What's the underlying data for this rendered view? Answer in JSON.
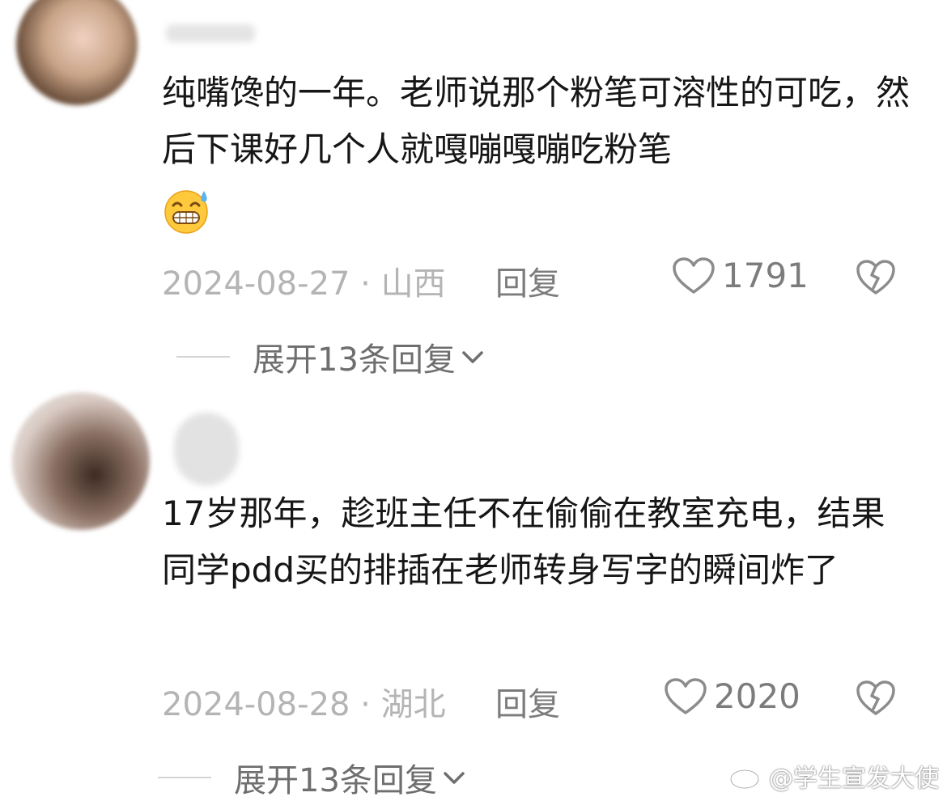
{
  "comments": [
    {
      "text": "纯嘴馋的一年。老师说那个粉笔可溶性的可吃，然后下课好几个人就嘎嘣嘎嘣吃粉笔",
      "emoji": "grinning-sweat-emoji",
      "date_location": "2024-08-27 · 山西",
      "reply_label": "回复",
      "likes": "1791",
      "expand_label": "展开13条回复"
    },
    {
      "text": "17岁那年，趁班主任不在偷偷在教室充电，结果同学pdd买的排插在老师转身写字的瞬间炸了",
      "date_location": "2024-08-28 · 湖北",
      "reply_label": "回复",
      "likes": "2020",
      "expand_label": "展开13条回复"
    }
  ],
  "watermark": {
    "text": "@学生宣发大使",
    "icon": "weibo-icon"
  },
  "icons": {
    "like": "heart-outline-icon",
    "dislike": "broken-heart-icon",
    "expand": "chevron-down-icon"
  },
  "colors": {
    "primary_text": "#161616",
    "meta_text": "#b4b4b4",
    "secondary_text": "#7c7c7c",
    "background": "#ffffff"
  }
}
